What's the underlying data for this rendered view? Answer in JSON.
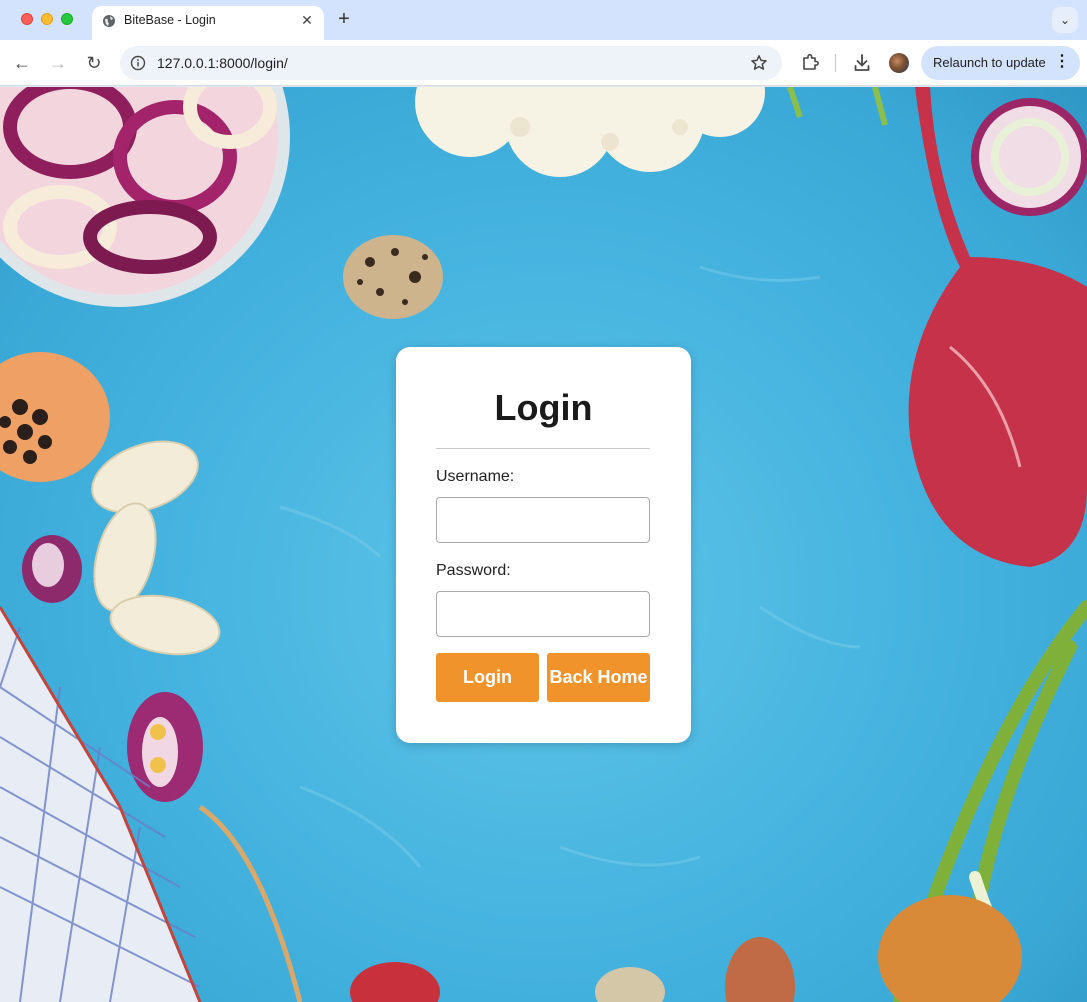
{
  "browser": {
    "tab_title": "BiteBase - Login",
    "tab_close": "✕",
    "new_tab": "+",
    "tab_menu": "⌄",
    "url": "127.0.0.1:8000/login/",
    "relaunch_label": "Relaunch to update",
    "relaunch_menu": "⋮",
    "nav": {
      "back": "←",
      "forward": "→",
      "reload": "↻"
    }
  },
  "login_card": {
    "title": "Login",
    "username_label": "Username:",
    "username_value": "",
    "password_label": "Password:",
    "password_value": "",
    "login_button": "Login",
    "back_home_button": "Back Home"
  },
  "colors": {
    "accent": "#f0932b",
    "page_background": "#47b5e0",
    "tabbar": "#d3e3fd"
  }
}
